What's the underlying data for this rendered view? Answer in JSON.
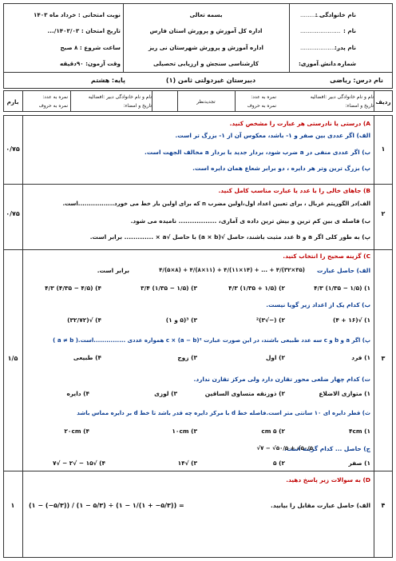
{
  "header": {
    "basmala": "بسمه تعالی",
    "exam_turn": "نوبت امتحانی : خرداد ماه ۱۴۰۳",
    "exam_date": "تاریخ امتحان : ۱۴۰۳/۰۳/...",
    "start_time": "ساعت شروع : ۸ صبح",
    "duration": "وقت آزمون: ۹۰دقیقه",
    "office1": "اداره کل آموزش و پرورش استان فارس",
    "office2": "اداره آموزش و پرورش شهرستان نی ریز",
    "office3": "کارشناسی سنجش و ارزیابی تحصیلی",
    "school": "دبیرستان غیردولتی ثامن (۱)",
    "grade": "پایه: هشتم",
    "family_name": "نام خانوادگی :",
    "name": "نام :",
    "father_name": "نام پدر:",
    "student_number": "شماره دانش آموزی:",
    "subject": "نام درس: ریاضی",
    "family_dots": "......................",
    "name_dots": "......................",
    "father_dots": "......................",
    "number_dots": "......................"
  },
  "grading_row": {
    "radif": "ردیف",
    "score_in_numbers_1": "نمره به عدد:",
    "score_in_words_1": "نمره به حروف",
    "teacher_name_1": "نام و نام خانوادگی دبیر :افضالیه",
    "date_signature_1": "تاریخ و امضاء:",
    "revision": "تجدیدنظر",
    "score_in_numbers_2": "نمره به عدد:",
    "score_in_words_2": "نمره به حروف",
    "teacher_name_2": "نام و نام خانوادگی دبیر :افضالیه",
    "date_signature_2": "تاریخ و امضاء:",
    "barom": "بارم"
  },
  "sections": {
    "A": {
      "num": "۱",
      "score": "۰/۷۵",
      "title": "A) درستی یا نادرستی هر عبارت را مشخص کنید.",
      "items": [
        "الف) اگر عددی بین صفر و ۱- باشد، معکوس آن از ۱- بزرگ تر است.",
        "ب) اگر عددی منفی در a ضرب شود، بردار جدید با بردار a مخالف الجهت است.",
        "پ) بزرگ ترین وتر هر دایره ، دو برابر شعاع همان دایره است."
      ]
    },
    "B": {
      "num": "۲",
      "score": "۰/۷۵",
      "title": "B) جاهای خالی را با عدد یا عبارت مناسب کامل کنید.",
      "items": [
        "الف)در الگوریتم غربال ، برای تعیین اعداد اول،اولین مضرب n که برای اولین بار خط می خورد.................است.",
        "ب) فاصله ی بین کم ترین و بیش ترین داده ی آماری، ................. نامیده می شود.",
        "پ) به طور کلی اگر a و b عدد مثبت باشند، حاصل √(a × b) با حاصل √a × ............. برابر است."
      ]
    },
    "C": {
      "num": "۳",
      "score": "۱/۵",
      "title": "C) گزینه صحیح را انتخاب کنید.",
      "q1": "الف) حاصل عبارت",
      "q1_expr": "۴/(۵×۸) + ۴/(۸×۱۱) + ۴/(۱۱×۱۴) + ... + ۴/(۳۲×۳۵)",
      "q1_tail": "برابر است.",
      "q1_options": [
        "۱) (۱/۵ − ۱/۳۵) ۴/۳",
        "۲) (۱/۵ + ۱/۳۵) ۴/۳",
        "۳) (۱/۵ − ۱/۳۵) ۳/۴",
        "۴) (۴/۵ − ۴/۳۵) ۴/۳"
      ],
      "q2": "ب) کدام یک از اعداد زیر گویا نیست.",
      "q2_options": [
        "۱) √(۱۶ + ۴)",
        "۲) (−√۳)²",
        "۳) ³(۵ و ۱)",
        "۴) √(۳۲/۷۲)"
      ],
      "q3": "پ) اگر a و b و c سه عدد طبیعی باشند، در این صورت عبارت c × (a − b)² همواره عددی ...............است.( a ≠ b )",
      "q3_options": [
        "۱) فرد",
        "۲) اول",
        "۳) زوج",
        "۴) طبیعی"
      ],
      "q4": "ت) کدام چهار ضلعی محور تقارن دارد ولی مرکز تقارن ندارد.",
      "q4_options": [
        "۱) متوازی الاضلاع",
        "۲) ذوزنقه متساوی الساقین",
        "۳) لوزی",
        "۴) دایره"
      ],
      "q5": "ث) قطر دایره ای ۱۰ سانتی متر است.فاصله خط d با مرکز دایره چه قدر باشد تا خط d بر دایره مماس باشد",
      "q5_options": [
        "۱) ۴cm",
        "۲) ۵ cm",
        "۳) ۱۰cm",
        "۴) ۲۰cm"
      ],
      "q6": "ج) حاصل ... کدام گزینه است.",
      "q6_expr": "√۷ − √۵۰/۵ + √۵۰/۵",
      "q6_options": [
        "۱) صفر",
        "۲) ۵",
        "۳) √۱۴",
        "۴) √۱۵ − √۲ − √۷"
      ]
    },
    "D": {
      "num": "۴",
      "score": "۱",
      "title": "D) به سوالات زیر پاسخ دهید.",
      "q1": "الف) حاصل عبارت مقابل را بیابید.",
      "q1_expr": "(۱ − (−۵/۳)) / (۱ − ۵/۳) ÷ (۱ − ۱/(۱ + −۵/۳)) ="
    }
  }
}
